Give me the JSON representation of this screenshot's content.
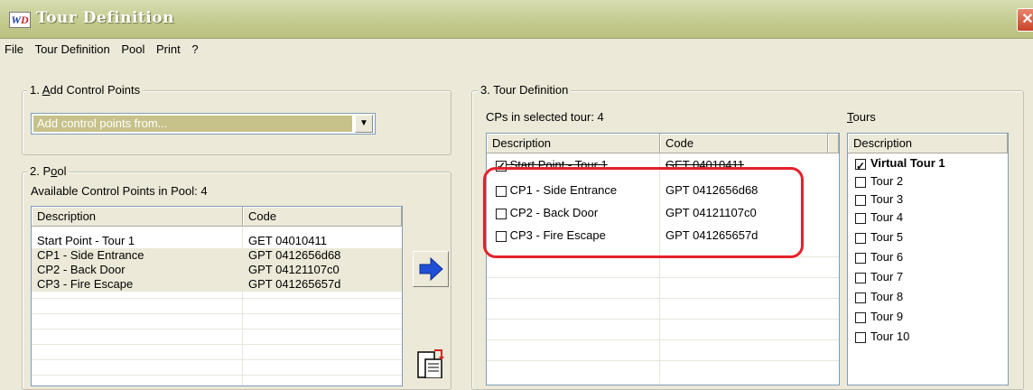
{
  "window": {
    "title": "Tour Definition",
    "close_glyph": "✕",
    "icon_label_left": "W",
    "icon_label_right": "D"
  },
  "menu": [
    "File",
    "Tour Definition",
    "Pool",
    "Print",
    "?"
  ],
  "add_cps": {
    "legend_num": "1. ",
    "legend_key": "A",
    "legend_rest": "dd Control Points",
    "combo_value": "Add control points from...",
    "combo_arrow": "▼"
  },
  "pool": {
    "legend_num": "2. P",
    "legend_key": "o",
    "legend_rest": "ol",
    "caption": "Available Control Points in Pool: 4",
    "columns": [
      "Description",
      "Code"
    ],
    "rows": [
      {
        "desc": "Start Point - Tour 1",
        "code": "GET 04010411"
      },
      {
        "desc": "CP1 - Side Entrance",
        "code": "GPT 0412656d68"
      },
      {
        "desc": "CP2 - Back Door",
        "code": "GPT 04121107c0"
      },
      {
        "desc": "CP3 - Fire Escape",
        "code": "GPT 041265657d"
      }
    ]
  },
  "tour_def": {
    "legend": "3. Tour Definition",
    "caption": "CPs in selected tour: 4",
    "columns": [
      "Description",
      "Code"
    ],
    "rows": [
      {
        "desc": "Start Point - Tour 1",
        "code": "GET 04010411",
        "checked": true
      },
      {
        "desc": "CP1 - Side Entrance",
        "code": "GPT 0412656d68",
        "checked": false
      },
      {
        "desc": "CP2 - Back Door",
        "code": "GPT 04121107c0",
        "checked": false
      },
      {
        "desc": "CP3 - Fire Escape",
        "code": "GPT 041265657d",
        "checked": false
      }
    ]
  },
  "tours": {
    "label_key": "T",
    "label_rest": "ours",
    "column": "Description",
    "items": [
      {
        "label": "Virtual Tour 1",
        "checked": true
      },
      {
        "label": "Tour 2",
        "checked": false
      },
      {
        "label": "Tour 3",
        "checked": false
      },
      {
        "label": "Tour 4",
        "checked": false
      },
      {
        "label": "Tour 5",
        "checked": false
      },
      {
        "label": "Tour 6",
        "checked": false
      },
      {
        "label": "Tour 7",
        "checked": false
      },
      {
        "label": "Tour 8",
        "checked": false
      },
      {
        "label": "Tour 9",
        "checked": false
      },
      {
        "label": "Tour 10",
        "checked": false
      }
    ]
  },
  "colors": {
    "title_bar": "#c3ca8d",
    "pool_selected": "#ece9d8",
    "highlight": "#e3222a",
    "arrow": "#1f4fd6"
  },
  "icons": [
    "app-logo-icon",
    "close-icon",
    "dropdown-arrow-icon",
    "right-arrow-icon",
    "paste-icon"
  ]
}
